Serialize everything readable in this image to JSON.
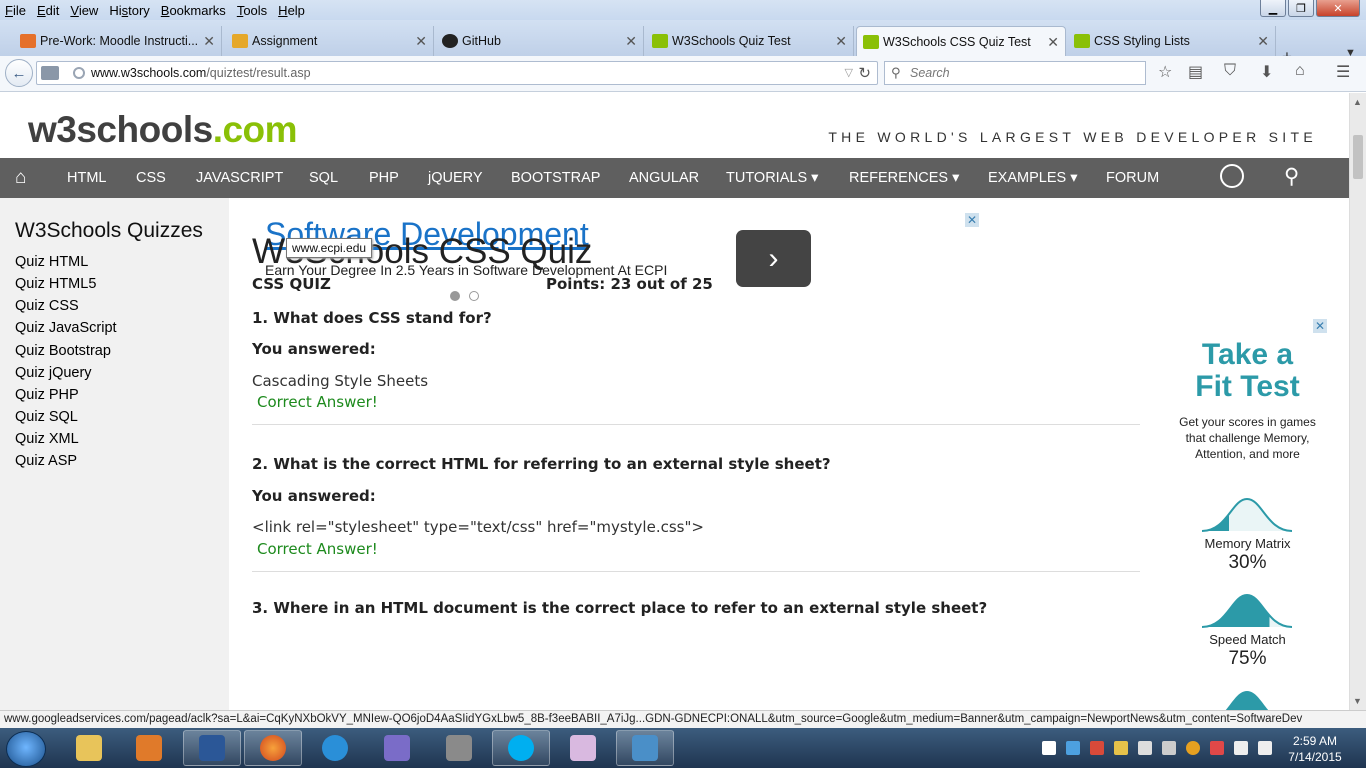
{
  "menu": [
    {
      "pre": "",
      "ul": "F",
      "post": "ile"
    },
    {
      "pre": "",
      "ul": "E",
      "post": "dit"
    },
    {
      "pre": "",
      "ul": "V",
      "post": "iew"
    },
    {
      "pre": "Hi",
      "ul": "s",
      "post": "tory"
    },
    {
      "pre": "",
      "ul": "B",
      "post": "ookmarks"
    },
    {
      "pre": "",
      "ul": "T",
      "post": "ools"
    },
    {
      "pre": "",
      "ul": "H",
      "post": "elp"
    }
  ],
  "tabs": [
    {
      "label": "Pre-Work: Moodle Instructi...",
      "icon_color": "#e5702a"
    },
    {
      "label": "Assignment",
      "icon_color": "#e5a82a"
    },
    {
      "label": "GitHub",
      "icon_color": "#222222"
    },
    {
      "label": "W3Schools Quiz Test",
      "icon_color": "#8ac007"
    },
    {
      "label": "W3Schools CSS Quiz Test",
      "icon_color": "#8ac007"
    },
    {
      "label": "CSS Styling Lists",
      "icon_color": "#8ac007"
    }
  ],
  "url": {
    "host": "www.w3schools.com",
    "path": "/quiztest/result.asp"
  },
  "search": {
    "placeholder": "Search"
  },
  "site": {
    "logo_main": "w3schools",
    "logo_tld": ".com",
    "tagline": "THE WORLD'S LARGEST WEB DEVELOPER SITE",
    "nav": [
      "HTML",
      "CSS",
      "JAVASCRIPT",
      "SQL",
      "PHP",
      "jQUERY",
      "BOOTSTRAP",
      "ANGULAR",
      "TUTORIALS ▾",
      "REFERENCES ▾",
      "EXAMPLES ▾",
      "FORUM"
    ]
  },
  "sidebar": {
    "title": "W3Schools Quizzes",
    "items": [
      "Quiz HTML",
      "Quiz HTML5",
      "Quiz CSS",
      "Quiz JavaScript",
      "Quiz Bootstrap",
      "Quiz jQuery",
      "Quiz PHP",
      "Quiz SQL",
      "Quiz XML",
      "Quiz ASP"
    ]
  },
  "ad": {
    "title": "Software Development",
    "subtitle": "Earn Your Degree In 2.5 Years in Software Development At ECPI",
    "tooltip": "www.ecpi.edu",
    "close": "✕",
    "arrow": "›"
  },
  "quiz": {
    "title": "W3Schools CSS Quiz",
    "label": "CSS QUIZ",
    "points": "Points: 23 out of 25",
    "answered_label": "You answered:",
    "questions": [
      {
        "q": "1. What does CSS stand for?",
        "a": "Cascading Style Sheets",
        "result": "Correct Answer!"
      },
      {
        "q": "2. What is the correct HTML for referring to an external style sheet?",
        "a": "<link rel=\"stylesheet\" type=\"text/css\" href=\"mystyle.css\">",
        "result": "Correct Answer!"
      },
      {
        "q": "3. Where in an HTML document is the correct place to refer to an external style sheet?"
      }
    ]
  },
  "right_ad": {
    "title_line1": "Take a",
    "title_line2": "Fit Test",
    "subtitle": "Get your scores in games that challenge Memory, Attention, and more",
    "items": [
      {
        "name": "Memory Matrix",
        "pct": "30%",
        "fill": 0.3
      },
      {
        "name": "Speed Match",
        "pct": "75%",
        "fill": 0.75
      }
    ],
    "accent": "#2c9aa8"
  },
  "status": "www.googleadservices.com/pagead/aclk?sa=L&ai=CqKyNXbOkVY_MNIew-QO6joD4AaSIidYGxLbw5_8B-f3eeBABII_A7iJg...GDN-GDNECPI:ONALL&utm_source=Google&utm_medium=Banner&utm_campaign=NewportNews&utm_content=SoftwareDev",
  "clock": {
    "time": "2:59 AM",
    "date": "7/14/2015"
  }
}
